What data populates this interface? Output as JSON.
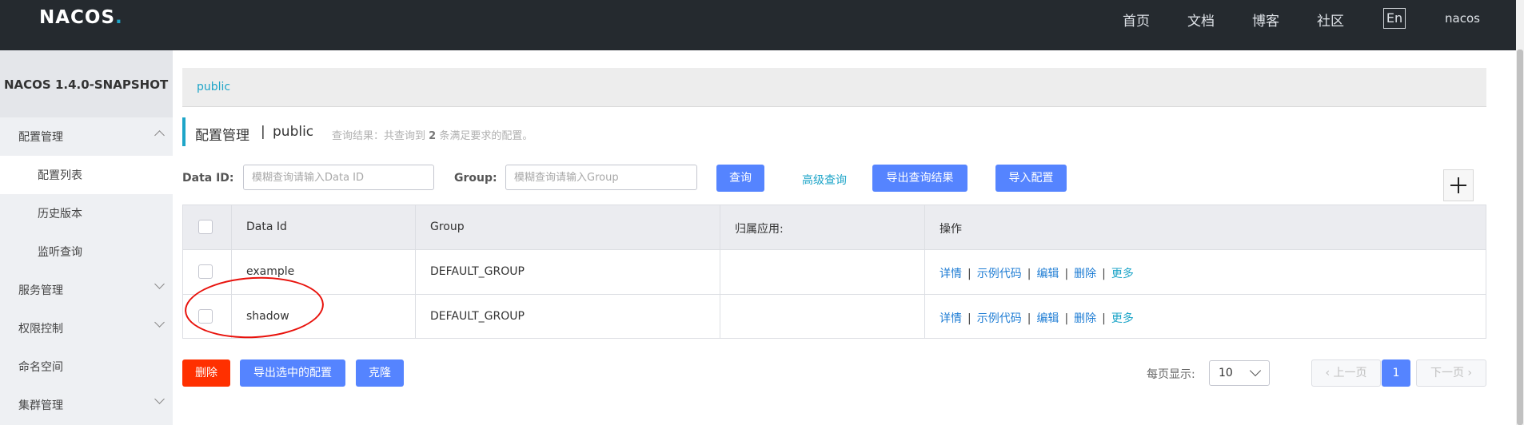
{
  "header": {
    "logo": "NACOS",
    "logo_dot": ".",
    "nav": [
      "首页",
      "文档",
      "博客",
      "社区"
    ],
    "lang": "En",
    "user": "nacos"
  },
  "sidebar": {
    "version": "NACOS 1.4.0-SNAPSHOT",
    "items": [
      {
        "label": "配置管理"
      },
      {
        "label": "配置列表"
      },
      {
        "label": "历史版本"
      },
      {
        "label": "监听查询"
      },
      {
        "label": "服务管理"
      },
      {
        "label": "权限控制"
      },
      {
        "label": "命名空间"
      },
      {
        "label": "集群管理"
      }
    ]
  },
  "breadcrumb": {
    "namespace": "public"
  },
  "title": {
    "text": "配置管理",
    "sep": "|",
    "namespace": "public",
    "hint_prefix": "查询结果：共查询到",
    "hint_count": "2",
    "hint_suffix": "条满足要求的配置。"
  },
  "filters": {
    "dataid_label": "Data ID:",
    "dataid_placeholder": "模糊查询请输入Data ID",
    "group_label": "Group:",
    "group_placeholder": "模糊查询请输入Group",
    "query_btn": "查询",
    "advanced": "高级查询",
    "export_btn": "导出查询结果",
    "import_btn": "导入配置"
  },
  "table": {
    "columns": [
      "Data Id",
      "Group",
      "归属应用:",
      "操作"
    ],
    "rows": [
      {
        "dataid": "example",
        "group": "DEFAULT_GROUP",
        "app": ""
      },
      {
        "dataid": "shadow",
        "group": "DEFAULT_GROUP",
        "app": ""
      }
    ],
    "ops": {
      "detail": "详情",
      "sample": "示例代码",
      "edit": "编辑",
      "delete": "删除",
      "more": "更多",
      "sep": "|"
    }
  },
  "footer": {
    "delete_btn": "删除",
    "export_selected_btn": "导出选中的配置",
    "clone_btn": "克隆",
    "page_size_label": "每页显示:",
    "page_size": "10",
    "prev": "上一页",
    "current_page": "1",
    "next": "下一页"
  },
  "colors": {
    "accent": "#1ea5c8",
    "primary": "#5584ff",
    "danger": "#ff3000",
    "annotation": "#e8120c"
  }
}
